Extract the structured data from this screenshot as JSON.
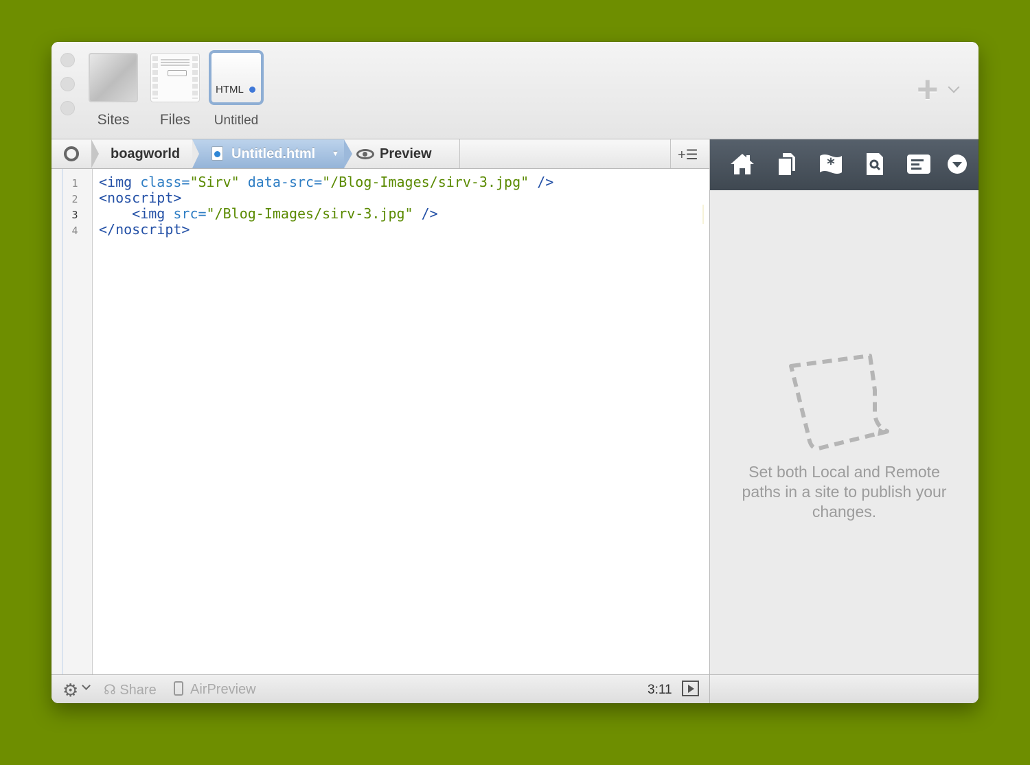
{
  "toolbar": {
    "sites_label": "Sites",
    "files_label": "Files",
    "untitled_label": "Untitled",
    "html_badge": "HTML",
    "add_icon": "plus-icon"
  },
  "pathbar": {
    "site": "boagworld",
    "file": "Untitled.html",
    "preview": "Preview"
  },
  "editor": {
    "line_numbers": [
      "1",
      "2",
      "3",
      "4"
    ],
    "current_line": "3"
  },
  "right_panel": {
    "tools": [
      "home-icon",
      "files-icon",
      "clips-icon",
      "search-icon",
      "symbols-icon",
      "dropdown-icon"
    ],
    "message_lines": [
      "Set both Local and Remote",
      "paths in a site to publish your",
      "changes."
    ]
  },
  "statusbar": {
    "share": "Share",
    "airpreview": "AirPreview",
    "cursor_position": "3:11"
  },
  "colors": {
    "background": "#6e8e00",
    "accent_tab": "#9cb9db",
    "tag": "#2350a6",
    "attribute": "#2f7ec4",
    "string": "#5a8a00"
  }
}
